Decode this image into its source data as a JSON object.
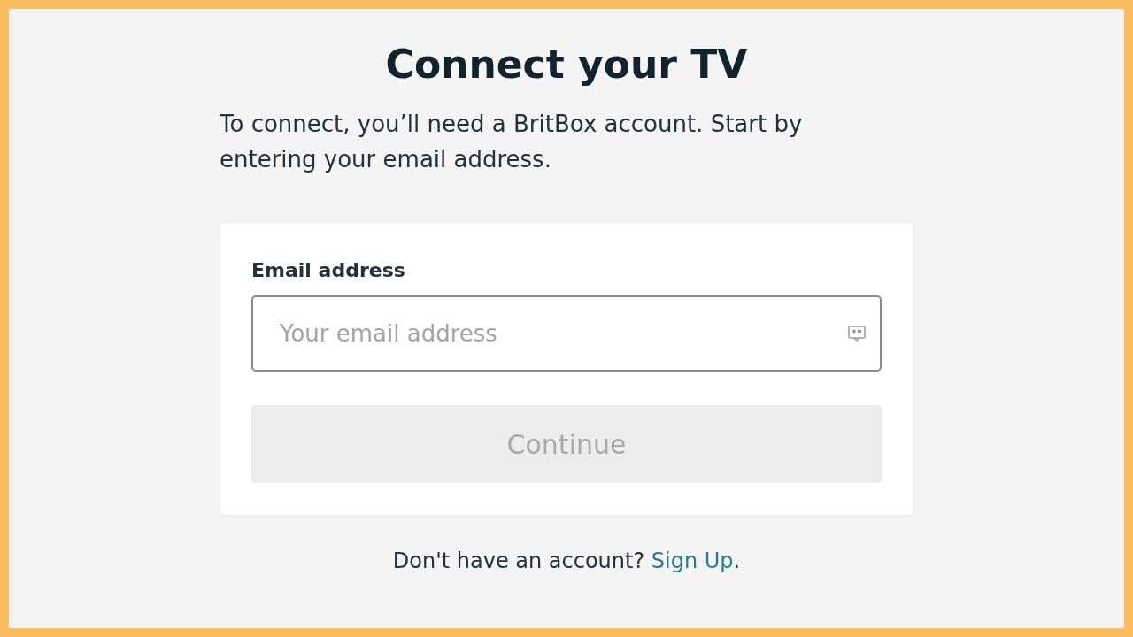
{
  "title": "Connect your TV",
  "intro": "To connect, you’ll need a BritBox account. Start by entering your email address.",
  "form": {
    "email_label": "Email address",
    "email_placeholder": "Your email address",
    "continue_button": {
      "label": "Continue",
      "disabled": true
    }
  },
  "footer": {
    "text": "Don't have an account?",
    "link": "Sign Up",
    "suffix": "."
  }
}
